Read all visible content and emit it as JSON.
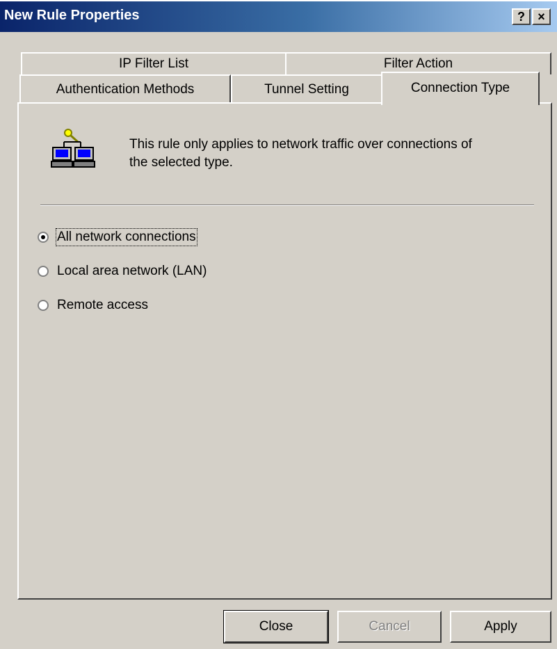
{
  "window": {
    "title": "New Rule Properties",
    "help_button": "?",
    "close_button": "×"
  },
  "tabs": {
    "back_row": [
      "IP Filter List",
      "Filter Action"
    ],
    "front_row": [
      "Authentication Methods",
      "Tunnel Setting",
      "Connection Type"
    ],
    "selected": "Connection Type"
  },
  "panel": {
    "icon": "network-computers-key-icon",
    "description": "This rule only applies to network traffic over connections of the selected type.",
    "description_line1": "This rule only applies to network traffic over connections of",
    "description_line2": "the selected type.",
    "options": [
      {
        "label": "All network connections",
        "checked": true
      },
      {
        "label": "Local area network (LAN)",
        "checked": false
      },
      {
        "label": "Remote access",
        "checked": false
      }
    ]
  },
  "buttons": {
    "close": "Close",
    "cancel": "Cancel",
    "apply": "Apply"
  },
  "colors": {
    "face": "#d4d0c8",
    "title_start": "#0a246a",
    "title_end": "#a6caf0"
  }
}
